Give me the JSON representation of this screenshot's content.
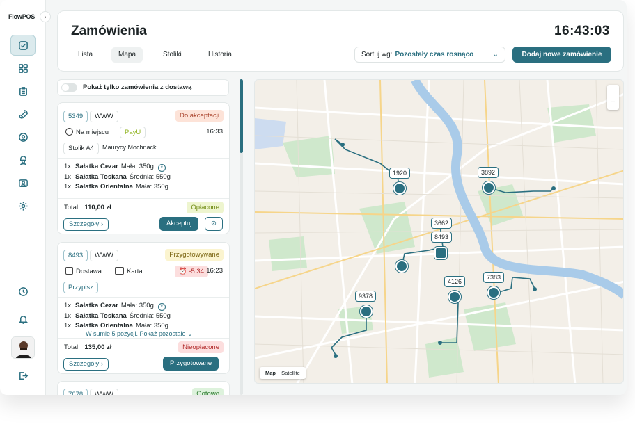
{
  "brand": "FlowPOS",
  "header": {
    "title": "Zamówienia",
    "clock": "16:43:03",
    "tabs": [
      "Lista",
      "Mapa",
      "Stoliki",
      "Historia"
    ],
    "active_tab": "Mapa",
    "sort_label": "Sortuj wg:",
    "sort_value": "Pozostały czas rosnąco",
    "add_button": "Dodaj nowe zamówienie"
  },
  "filter": {
    "delivery_only_label": "Pokaż tylko zamówienia z dostawą",
    "delivery_only_on": false
  },
  "orders": [
    {
      "number": "5349",
      "source": "WWW",
      "status": "Do akceptacji",
      "type": "Na miejscu",
      "payment": "PayU",
      "time": "16:33",
      "table": "Stolik A4",
      "customer": "Maurycy Mochnacki",
      "items": [
        {
          "qty": "1x",
          "name": "Sałatka Cezar",
          "size": "Mała: 350g"
        },
        {
          "qty": "1x",
          "name": "Sałatka Toskana",
          "size": "Średnia: 550g"
        },
        {
          "qty": "1x",
          "name": "Sałatka Orientalna",
          "size": "Mała: 350g"
        }
      ],
      "total_label": "Total:",
      "total": "110,00 zł",
      "paid_status": "Opłacone",
      "details_button": "Szczegóły",
      "action_button": "Akceptuj"
    },
    {
      "number": "8493",
      "source": "WWW",
      "status": "Przygotowywane",
      "type": "Dostawa",
      "payment": "Karta",
      "countdown": "-5:34",
      "time": "16:23",
      "assign_button": "Przypisz",
      "items": [
        {
          "qty": "1x",
          "name": "Sałatka Cezar",
          "size": "Mała: 350g"
        },
        {
          "qty": "1x",
          "name": "Sałatka Toskana",
          "size": "Średnia: 550g"
        },
        {
          "qty": "1x",
          "name": "Sałatka Orientalna",
          "size": "Mała: 350g"
        }
      ],
      "more_items": "W sumie 5 pozycji. Pokaż pozostałe",
      "total_label": "Total:",
      "total": "135,00 zł",
      "paid_status": "Nieopłacone",
      "details_button": "Szczegóły",
      "action_button": "Przygotowane"
    },
    {
      "number": "7678",
      "source": "WWW",
      "status": "Gotowe"
    }
  ],
  "map": {
    "markers": [
      "1920",
      "3892",
      "3662",
      "8493",
      "4126",
      "7383",
      "9378"
    ],
    "map_type_options": [
      "Map",
      "Satellite"
    ],
    "zoom_in": "+",
    "zoom_out": "−"
  },
  "colors": {
    "accent": "#2a6f80",
    "warning_bg": "#fde3d8",
    "prep_bg": "#fbf4cf",
    "paid_bg": "#eef5cf",
    "unpaid_bg": "#fcdede",
    "ready_bg": "#ddf2dc"
  }
}
